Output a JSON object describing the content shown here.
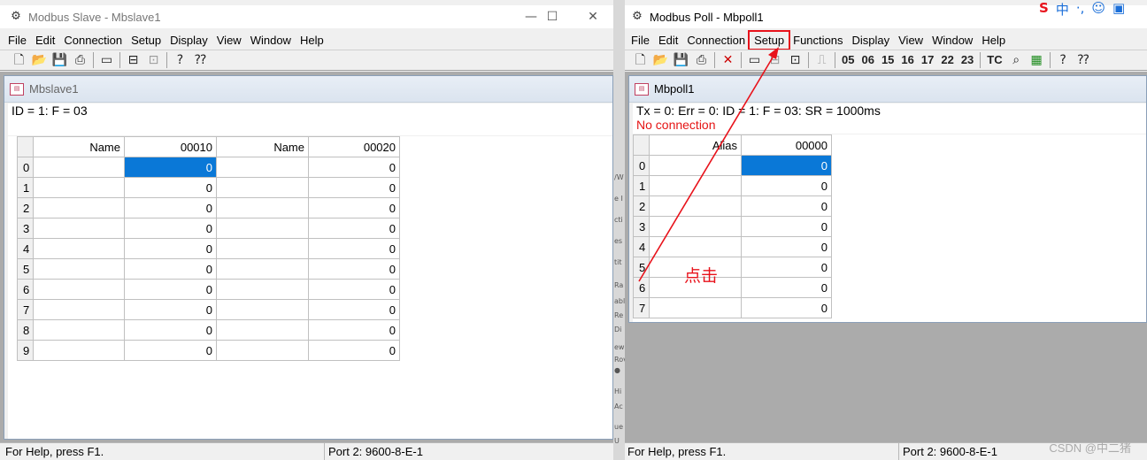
{
  "slave": {
    "title": "Modbus Slave - Mbslave1",
    "menu": [
      "File",
      "Edit",
      "Connection",
      "Setup",
      "Display",
      "View",
      "Window",
      "Help"
    ],
    "child_title": "Mbslave1",
    "info_line": "ID = 1: F = 03",
    "columns": [
      "Name",
      "00010",
      "Name",
      "00020"
    ],
    "rows": [
      "0",
      "1",
      "2",
      "3",
      "4",
      "5",
      "6",
      "7",
      "8",
      "9"
    ],
    "values_a": [
      "0",
      "0",
      "0",
      "0",
      "0",
      "0",
      "0",
      "0",
      "0",
      "0"
    ],
    "values_b": [
      "0",
      "0",
      "0",
      "0",
      "0",
      "0",
      "0",
      "0",
      "0",
      "0"
    ],
    "status_left": "For Help, press F1.",
    "status_right": "Port 2: 9600-8-E-1"
  },
  "poll": {
    "title": "Modbus Poll - Mbpoll1",
    "menu": [
      "File",
      "Edit",
      "Connection",
      "Setup",
      "Functions",
      "Display",
      "View",
      "Window",
      "Help"
    ],
    "toolbar_codes": [
      "05",
      "06",
      "15",
      "16",
      "17",
      "22",
      "23",
      "TC"
    ],
    "child_title": "Mbpoll1",
    "info_line": "Tx = 0: Err = 0: ID = 1: F = 03: SR = 1000ms",
    "error_line": "No connection",
    "columns": [
      "Alias",
      "00000"
    ],
    "rows": [
      "0",
      "1",
      "2",
      "3",
      "4",
      "5",
      "6",
      "7"
    ],
    "values": [
      "0",
      "0",
      "0",
      "0",
      "0",
      "0",
      "0",
      "0"
    ],
    "status_left": "For Help, press F1.",
    "status_right": "Port 2: 9600-8-E-1"
  },
  "annotation": {
    "label": "点击",
    "color": "#e8121b"
  },
  "watermark": "CSDN @中二猪",
  "colors": {
    "selection": "#0a78d7",
    "error_text": "#e51414"
  }
}
